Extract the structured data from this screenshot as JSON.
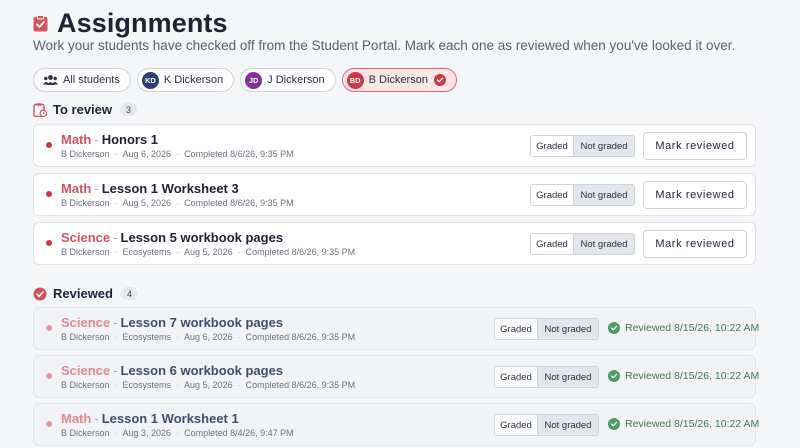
{
  "header": {
    "title": "Assignments",
    "subtitle": "Work your students have checked off from the Student Portal. Mark each one as reviewed when you've looked it over."
  },
  "filters": [
    {
      "label": "All students",
      "icon": "people-icon",
      "active": false
    },
    {
      "label": "K Dickerson",
      "initials": "KD",
      "color": "#2f3f6e",
      "active": false
    },
    {
      "label": "J Dickerson",
      "initials": "JD",
      "color": "#8a2d9c",
      "active": false
    },
    {
      "label": "B Dickerson",
      "initials": "BD",
      "color": "#c93a48",
      "active": true
    }
  ],
  "to_review": {
    "title": "To review",
    "count": "3",
    "items": [
      {
        "subject": "Math",
        "title": "Honors 1",
        "student": "B Dickerson",
        "unit": "",
        "date": "Aug 6, 2026",
        "completed": "Completed 8/6/26, 9:35 PM",
        "graded": "Graded",
        "not_graded": "Not graded",
        "action": "Mark reviewed"
      },
      {
        "subject": "Math",
        "title": "Lesson 1 Worksheet 3",
        "student": "B Dickerson",
        "unit": "",
        "date": "Aug 5, 2026",
        "completed": "Completed 8/6/26, 9:35 PM",
        "graded": "Graded",
        "not_graded": "Not graded",
        "action": "Mark reviewed"
      },
      {
        "subject": "Science",
        "title": "Lesson 5 workbook pages",
        "student": "B Dickerson",
        "unit": "Ecosystems",
        "date": "Aug 5, 2026",
        "completed": "Completed 8/6/26, 9:35 PM",
        "graded": "Graded",
        "not_graded": "Not graded",
        "action": "Mark reviewed"
      }
    ]
  },
  "reviewed": {
    "title": "Reviewed",
    "count": "4",
    "items": [
      {
        "subject": "Science",
        "title": "Lesson 7 workbook pages",
        "student": "B Dickerson",
        "unit": "Ecosystems",
        "date": "Aug 6, 2026",
        "completed": "Completed 8/6/26, 9:35 PM",
        "graded": "Graded",
        "not_graded": "Not graded",
        "status": "Reviewed 8/15/26, 10:22 AM"
      },
      {
        "subject": "Science",
        "title": "Lesson 6 workbook pages",
        "student": "B Dickerson",
        "unit": "Ecosystems",
        "date": "Aug 5, 2026",
        "completed": "Completed 8/6/26, 9:35 PM",
        "graded": "Graded",
        "not_graded": "Not graded",
        "status": "Reviewed 8/15/26, 10:22 AM"
      },
      {
        "subject": "Math",
        "title": "Lesson 1 Worksheet 1",
        "student": "B Dickerson",
        "unit": "",
        "date": "Aug 3, 2026",
        "completed": "Completed 8/4/26, 9:47 PM",
        "graded": "Graded",
        "not_graded": "Not graded",
        "status": "Reviewed 8/15/26, 10:22 AM"
      }
    ]
  },
  "colors": {
    "accent": "#c93a48",
    "reviewed_green": "#4b9a63"
  }
}
